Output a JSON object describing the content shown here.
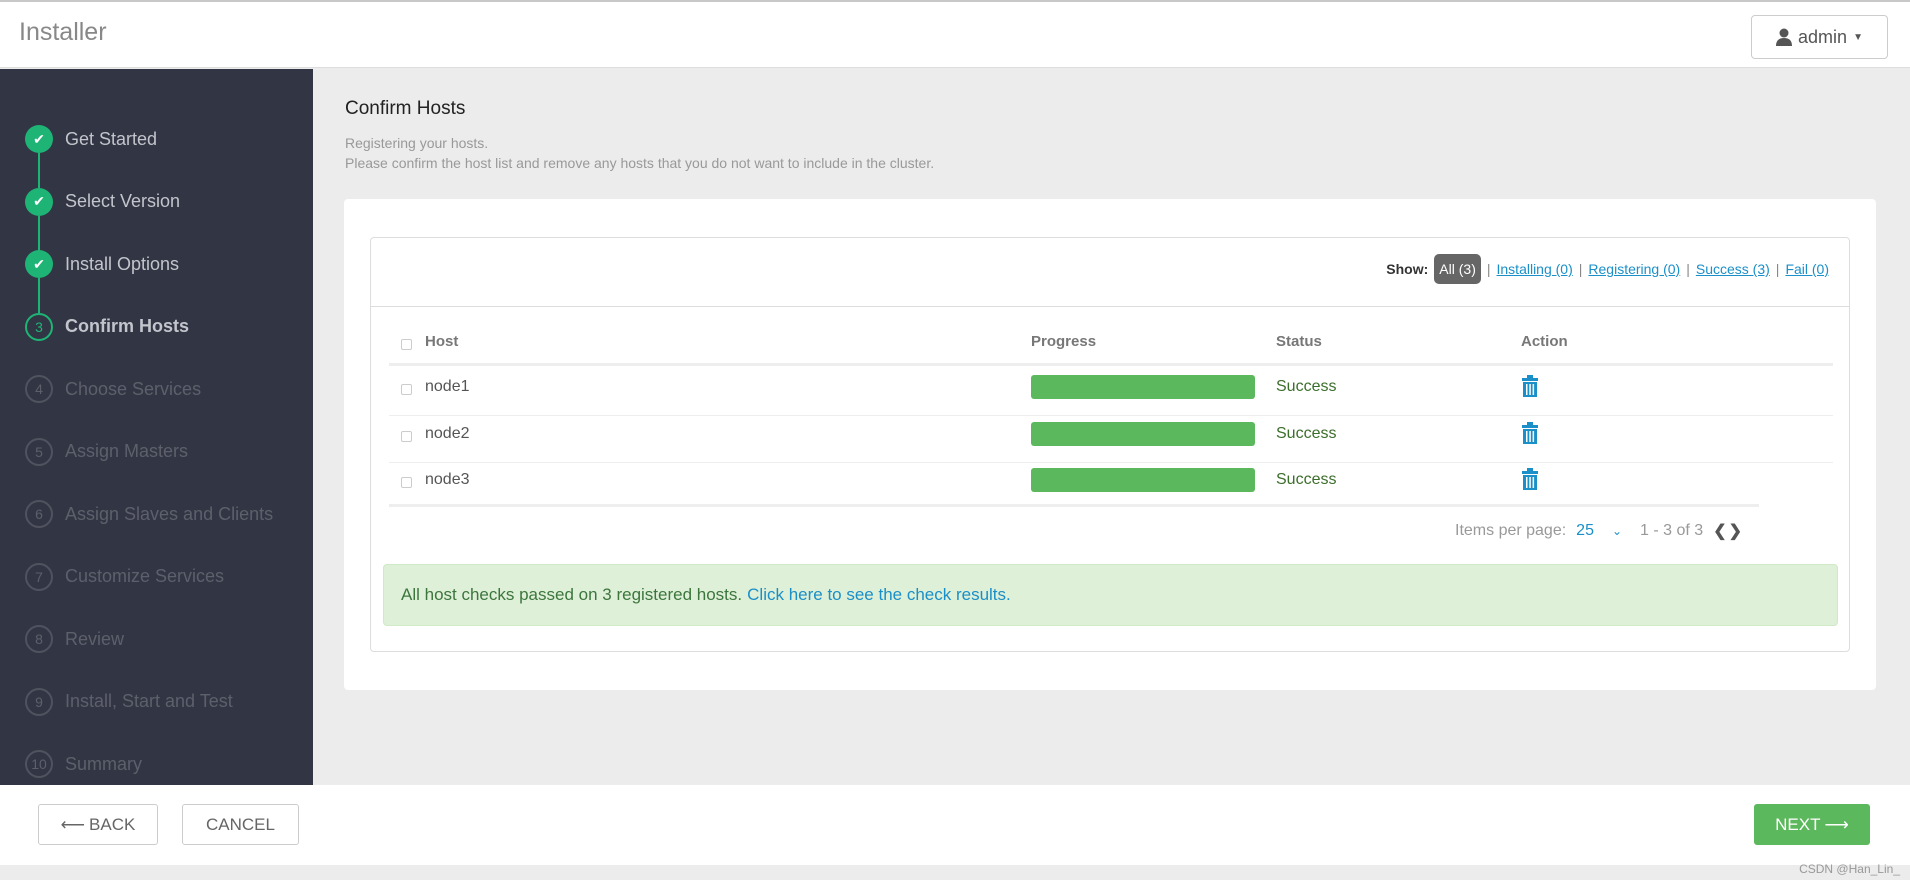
{
  "header": {
    "title": "Installer",
    "user": "admin"
  },
  "sidebar": {
    "steps": [
      {
        "num": "1",
        "label": "Get Started",
        "state": "done"
      },
      {
        "num": "2",
        "label": "Select Version",
        "state": "done"
      },
      {
        "num": "3",
        "label": "Install Options",
        "state": "done"
      },
      {
        "num": "3",
        "label": "Confirm Hosts",
        "state": "current"
      },
      {
        "num": "4",
        "label": "Choose Services",
        "state": "todo"
      },
      {
        "num": "5",
        "label": "Assign Masters",
        "state": "todo"
      },
      {
        "num": "6",
        "label": "Assign Slaves and Clients",
        "state": "todo"
      },
      {
        "num": "7",
        "label": "Customize Services",
        "state": "todo"
      },
      {
        "num": "8",
        "label": "Review",
        "state": "todo"
      },
      {
        "num": "9",
        "label": "Install, Start and Test",
        "state": "todo"
      },
      {
        "num": "10",
        "label": "Summary",
        "state": "todo"
      }
    ]
  },
  "main": {
    "title": "Confirm Hosts",
    "subtitle1": "Registering your hosts.",
    "subtitle2": "Please confirm the host list and remove any hosts that you do not want to include in the cluster.",
    "filters": {
      "show_label": "Show:",
      "all": "All (3)",
      "installing": "Installing (0)",
      "registering": "Registering (0)",
      "success": "Success (3)",
      "fail": "Fail (0)",
      "sep": "|"
    },
    "columns": {
      "host": "Host",
      "progress": "Progress",
      "status": "Status",
      "action": "Action"
    },
    "rows": [
      {
        "host": "node1",
        "progress": 100,
        "status": "Success"
      },
      {
        "host": "node2",
        "progress": 100,
        "status": "Success"
      },
      {
        "host": "node3",
        "progress": 100,
        "status": "Success"
      }
    ],
    "pagination": {
      "label": "Items per page:",
      "per_page": "25",
      "range": "1 - 3 of 3"
    },
    "alert": {
      "text": "All host checks passed on 3 registered hosts.",
      "link": "Click here to see the check results."
    }
  },
  "footer": {
    "back": "BACK",
    "cancel": "CANCEL",
    "next": "NEXT"
  },
  "watermark": "CSDN @Han_Lin_",
  "colors": {
    "accent": "#1eb475",
    "progress": "#5cb85c",
    "link": "#1a8fc8",
    "sidebar": "#323544"
  }
}
